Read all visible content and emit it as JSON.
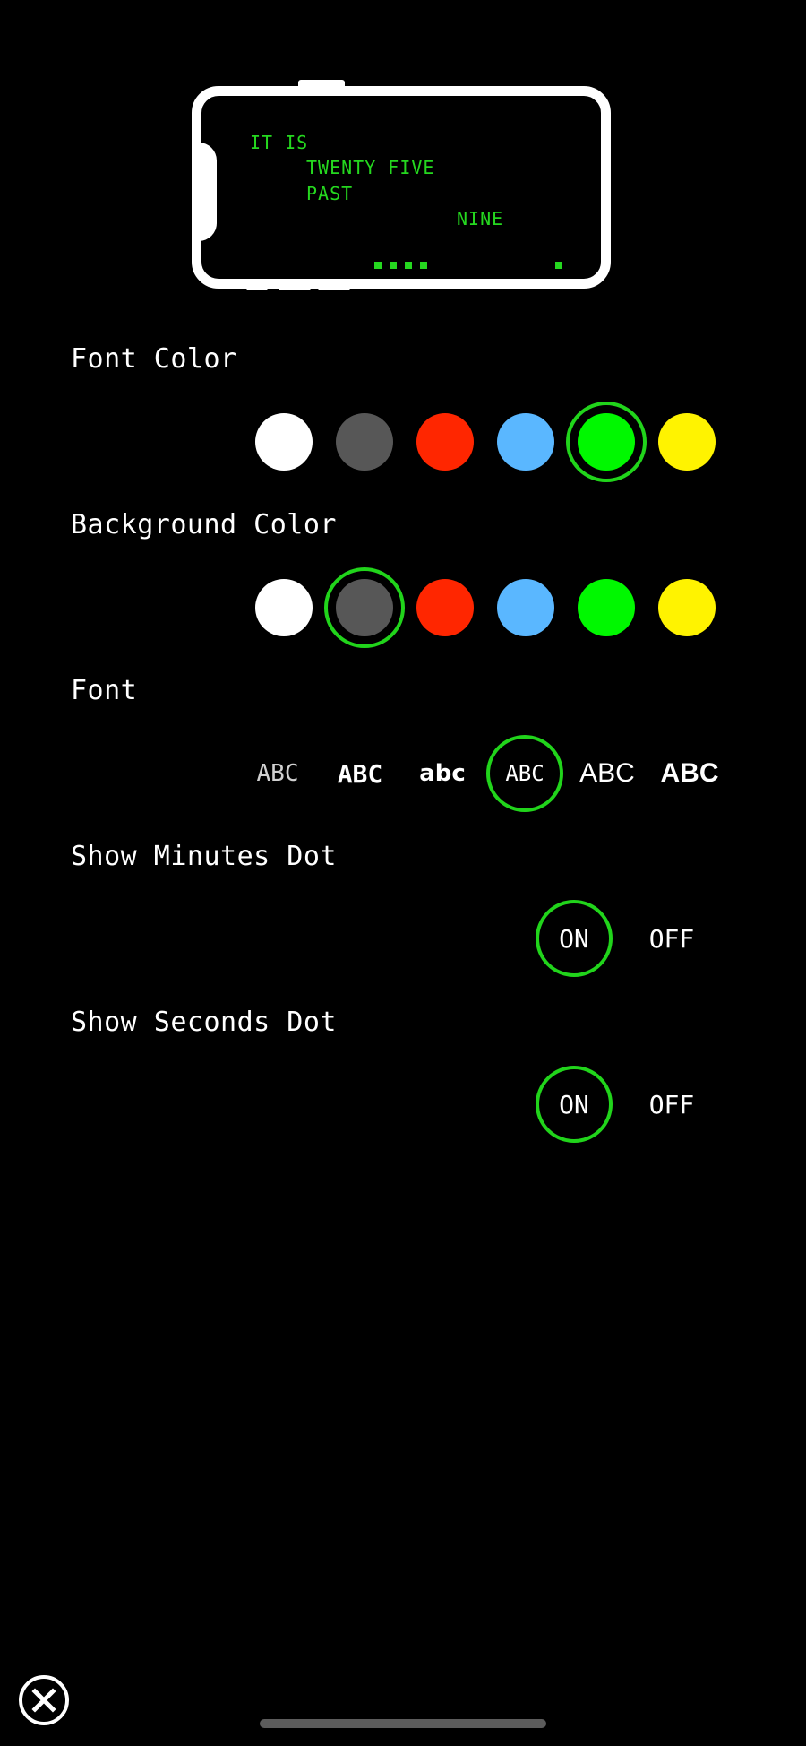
{
  "preview": {
    "line1": "IT IS",
    "line2": "TWENTY FIVE",
    "line3": "PAST",
    "line4": "NINE",
    "text_color": "#25d81f"
  },
  "font_color": {
    "label": "Font Color",
    "options": [
      "#ffffff",
      "#575757",
      "#ff2600",
      "#5ab7ff",
      "#00f800",
      "#fff300"
    ],
    "selected_index": 4
  },
  "background_color": {
    "label": "Background Color",
    "options": [
      "#ffffff",
      "#575757",
      "#ff2600",
      "#5ab7ff",
      "#00f800",
      "#fff300"
    ],
    "selected_index": 1
  },
  "font": {
    "label": "Font",
    "options": [
      "ABC",
      "ABC",
      "abc",
      "ABC",
      "ABC",
      "ABC"
    ],
    "selected_index": 3
  },
  "minutes_dot": {
    "label": "Show Minutes Dot",
    "on": "ON",
    "off": "OFF",
    "selected": "ON"
  },
  "seconds_dot": {
    "label": "Show Seconds Dot",
    "on": "ON",
    "off": "OFF",
    "selected": "ON"
  },
  "accent_color": "#21d41b"
}
